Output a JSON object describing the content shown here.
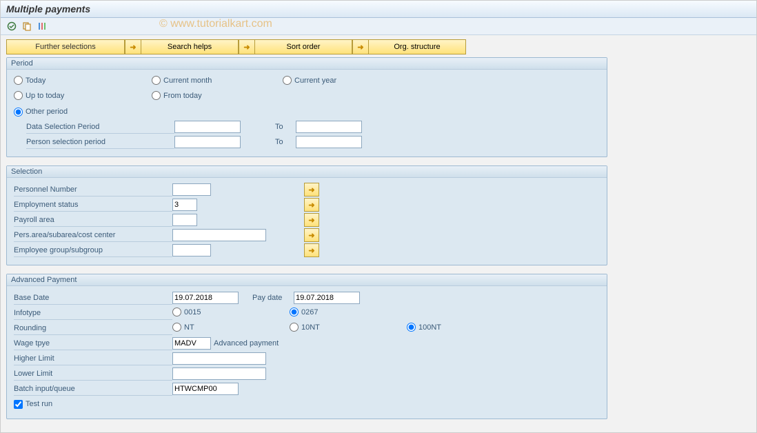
{
  "title": "Multiple payments",
  "watermark": "© www.tutorialkart.com",
  "menu": {
    "further_selections": "Further selections",
    "search_helps": "Search helps",
    "sort_order": "Sort order",
    "org_structure": "Org. structure"
  },
  "period": {
    "group_title": "Period",
    "today": "Today",
    "current_month": "Current month",
    "current_year": "Current year",
    "up_to_today": "Up to today",
    "from_today": "From today",
    "other_period": "Other period",
    "data_sel_period": "Data Selection Period",
    "person_sel_period": "Person selection period",
    "to": "To"
  },
  "selection": {
    "group_title": "Selection",
    "personnel_number": "Personnel Number",
    "employment_status": "Employment status",
    "employment_status_val": "3",
    "payroll_area": "Payroll area",
    "pers_area": "Pers.area/subarea/cost center",
    "emp_group": "Employee group/subgroup"
  },
  "adv_payment": {
    "group_title": "Advanced Payment",
    "base_date": "Base Date",
    "base_date_val": "19.07.2018",
    "pay_date": "Pay date",
    "pay_date_val": "19.07.2018",
    "infotype": "Infotype",
    "infotype_0015": "0015",
    "infotype_0267": "0267",
    "rounding": "Rounding",
    "rounding_nt": "NT",
    "rounding_10nt": "10NT",
    "rounding_100nt": "100NT",
    "wage_type": "Wage tpye",
    "wage_type_code": "MADV",
    "wage_type_desc": "Advanced payment",
    "higher_limit": "Higher Limit",
    "lower_limit": "Lower Limit",
    "batch_queue": "Batch input/queue",
    "batch_queue_val": "HTWCMP00",
    "test_run": "Test run"
  }
}
